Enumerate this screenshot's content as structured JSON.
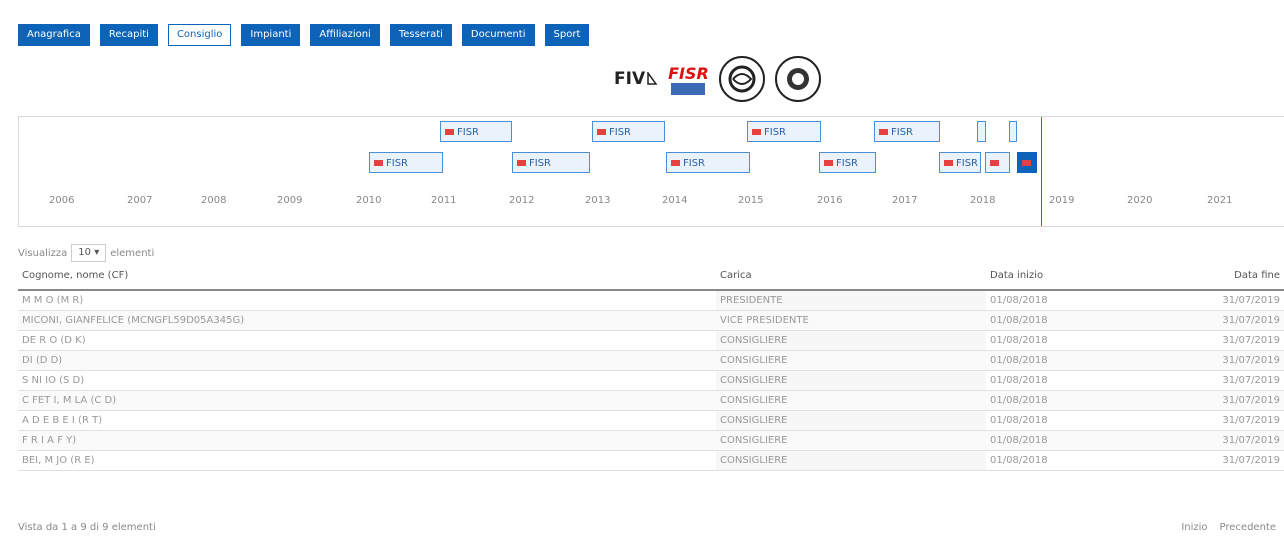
{
  "tabs": [
    {
      "label": "Anagrafica",
      "active": false
    },
    {
      "label": "Recapiti",
      "active": false
    },
    {
      "label": "Consiglio",
      "active": true
    },
    {
      "label": "Impianti",
      "active": false
    },
    {
      "label": "Affiliazioni",
      "active": false
    },
    {
      "label": "Tesserati",
      "active": false
    },
    {
      "label": "Documenti",
      "active": false
    },
    {
      "label": "Sport",
      "active": false
    }
  ],
  "logos": {
    "fiv": "FIV",
    "fisr": "FISR"
  },
  "timeline": {
    "years": [
      "2006",
      "2007",
      "2008",
      "2009",
      "2010",
      "2011",
      "2012",
      "2013",
      "2014",
      "2015",
      "2016",
      "2017",
      "2018",
      "2019",
      "2020",
      "2021"
    ],
    "item_label": "FISR"
  },
  "list_controls": {
    "prefix": "Visualizza",
    "page_size": "10",
    "suffix": "elementi"
  },
  "table": {
    "headers": [
      "Cognome, nome (CF)",
      "Carica",
      "Data inizio",
      "Data fine"
    ],
    "rows": [
      [
        "M     M   O (M                          R)",
        "PRESIDENTE",
        "01/08/2018",
        "31/07/2019"
      ],
      [
        "MICONI, GIANFELICE (MCNGFL59D05A345G)",
        "VICE PRESIDENTE",
        "01/08/2018",
        "31/07/2019"
      ],
      [
        "DE                    R   O (D              K)",
        "CONSIGLIERE",
        "01/08/2018",
        "31/07/2019"
      ],
      [
        "DI            (D                   D)",
        "CONSIGLIERE",
        "01/08/2018",
        "31/07/2019"
      ],
      [
        "S       NI    IO (S                   D)",
        "CONSIGLIERE",
        "01/08/2018",
        "31/07/2019"
      ],
      [
        "C  FET  I, M        LA (C                  D)",
        "CONSIGLIERE",
        "01/08/2018",
        "31/07/2019"
      ],
      [
        "A  D E B    E  I (R                    T)",
        "CONSIGLIERE",
        "01/08/2018",
        "31/07/2019"
      ],
      [
        "F  R   I A    F              Y)",
        "CONSIGLIERE",
        "01/08/2018",
        "31/07/2019"
      ],
      [
        "    BEI,  M   JO (R                   E)",
        "CONSIGLIERE",
        "01/08/2018",
        "31/07/2019"
      ]
    ]
  },
  "footer": {
    "info": "Vista da 1 a 9 di 9 elementi",
    "first": "Inizio",
    "prev": "Precedente"
  }
}
